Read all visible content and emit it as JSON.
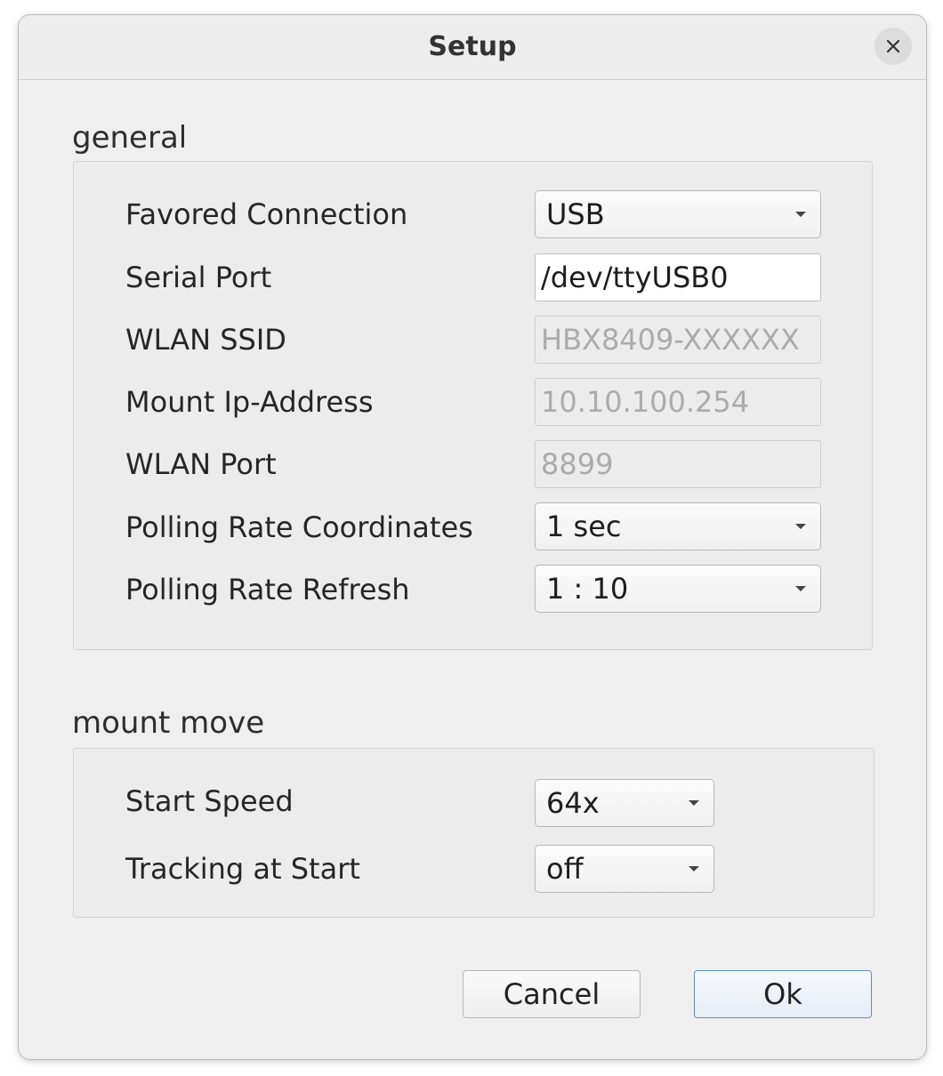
{
  "window": {
    "title": "Setup"
  },
  "general": {
    "label": "general",
    "rows": [
      {
        "label": "Favored Connection",
        "value": "USB"
      },
      {
        "label": "Serial Port",
        "value": "/dev/ttyUSB0"
      },
      {
        "label": "WLAN SSID",
        "value": "HBX8409-XXXXXX"
      },
      {
        "label": "Mount Ip-Address",
        "value": "10.10.100.254"
      },
      {
        "label": "WLAN Port",
        "value": "8899"
      },
      {
        "label": "Polling Rate Coordinates",
        "value": "1 sec"
      },
      {
        "label": "Polling Rate Refresh",
        "value": "1 : 10"
      }
    ]
  },
  "mount_move": {
    "label": "mount move",
    "rows": [
      {
        "label": "Start Speed",
        "value": "64x"
      },
      {
        "label": "Tracking at Start",
        "value": "off"
      }
    ]
  },
  "buttons": {
    "cancel": "Cancel",
    "ok": "Ok"
  },
  "colors": {
    "dialog_background": "#efefef",
    "default_button_border": "#5b8fc7",
    "disabled_text": "#ababab"
  },
  "icons": {
    "close": "close-icon",
    "dropdown": "chevron-down-icon"
  }
}
